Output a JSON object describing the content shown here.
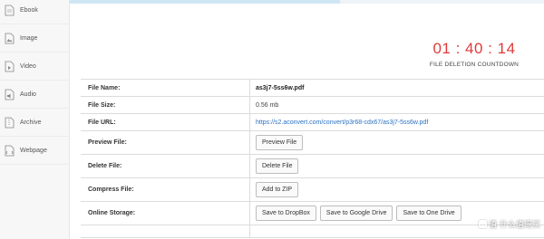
{
  "sidebar": {
    "items": [
      {
        "label": "Ebook",
        "icon": "ebook-icon"
      },
      {
        "label": "Image",
        "icon": "image-icon"
      },
      {
        "label": "Video",
        "icon": "video-icon"
      },
      {
        "label": "Audio",
        "icon": "audio-icon"
      },
      {
        "label": "Archive",
        "icon": "archive-icon"
      },
      {
        "label": "Webpage",
        "icon": "webpage-icon"
      }
    ]
  },
  "countdown": {
    "time": "01 : 40 : 14",
    "caption": "FILE DELETION COUNTDOWN",
    "color": "#e03a3a"
  },
  "file": {
    "name_label": "File Name:",
    "name": "as3j7-5ss6w.pdf",
    "size_label": "File Size:",
    "size": "0.56 mb",
    "url_label": "File URL:",
    "url": "https://s2.aconvert.com/convert/p3r68-cdx67/as3j7-5ss6w.pdf",
    "preview_label": "Preview File:",
    "preview_button": "Preview File",
    "delete_label": "Delete File:",
    "delete_button": "Delete File",
    "compress_label": "Compress File:",
    "compress_button": "Add to ZIP",
    "storage_label": "Online Storage:",
    "storage_buttons": [
      "Save to DropBox",
      "Save to Google Drive",
      "Save to One Drive"
    ]
  },
  "watermark": "值 什么值得买",
  "accent": "#2b72c2"
}
